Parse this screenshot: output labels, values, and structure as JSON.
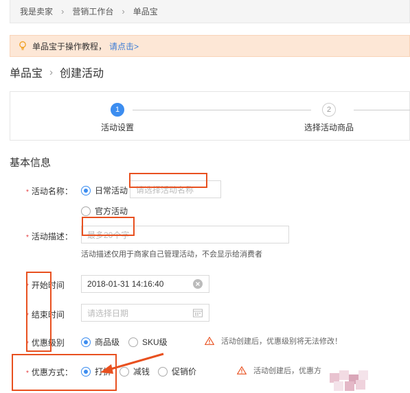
{
  "breadcrumb": {
    "items": [
      "我是卖家",
      "营销工作台",
      "单品宝"
    ]
  },
  "tip": {
    "text": "单品宝于操作教程，",
    "link": "请点击>"
  },
  "page_title": {
    "parent": "单品宝",
    "current": "创建活动"
  },
  "steps": [
    {
      "number": "1",
      "label": "活动设置"
    },
    {
      "number": "2",
      "label": "选择活动商品"
    }
  ],
  "section_title": "基本信息",
  "form": {
    "required_mark": "*",
    "name": {
      "label": "活动名称：",
      "opt_daily": "日常活动",
      "opt_official": "官方活动",
      "placeholder": "请选择活动名称"
    },
    "desc": {
      "label": "活动描述：",
      "placeholder": "最多20个字",
      "hint": "活动描述仅用于商家自己管理活动，不会显示给消费者"
    },
    "start": {
      "label": "开始时间",
      "value": "2018-01-31 14:16:40"
    },
    "end": {
      "label": "结束时间",
      "placeholder": "请选择日期"
    },
    "level": {
      "label": "优惠级别",
      "opt_product": "商品级",
      "opt_sku": "SKU级",
      "warning": "活动创建后，优惠级别将无法修改！"
    },
    "method": {
      "label": "优惠方式：",
      "opt_discount": "打折",
      "opt_reduce": "减钱",
      "opt_price": "促销价",
      "warning": "活动创建后，优惠方"
    }
  },
  "colors": {
    "accent": "#3c8df0",
    "annotation": "#e8501f",
    "required": "#e4393c",
    "tip_bg": "#fde7d6"
  },
  "icons": [
    "chevron-right-icon",
    "lightbulb-icon",
    "clear-icon",
    "calendar-icon",
    "warning-icon",
    "arrow-annotation"
  ]
}
